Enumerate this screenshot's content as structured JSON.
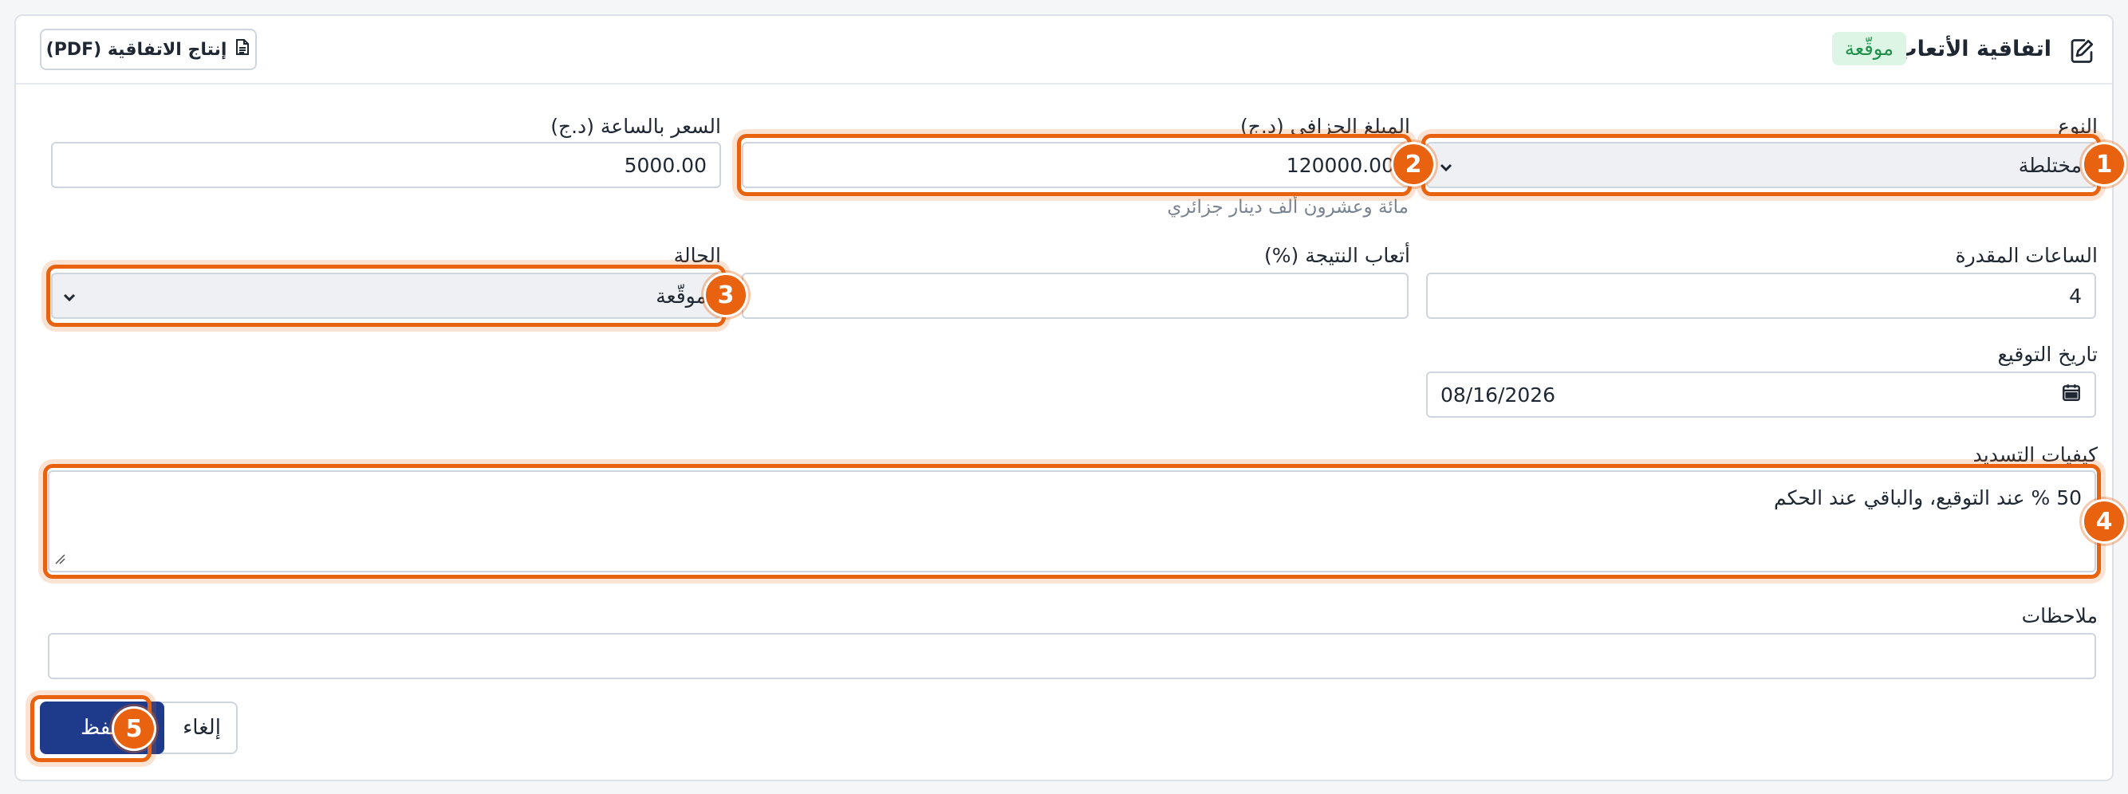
{
  "header": {
    "title": "اتفاقية الأتعاب",
    "status_badge": "موقّعة",
    "pdf_button": "إنتاج الاتفاقية (PDF)"
  },
  "form": {
    "type": {
      "label": "النوع",
      "value": "مختلطة"
    },
    "fixed_amount": {
      "label": "المبلغ الجزافي (د.ج)",
      "value": "120000.00",
      "hint": "مائة وعشرون ألف دينار جزائري"
    },
    "hourly_rate": {
      "label": "السعر بالساعة (د.ج)",
      "value": "5000.00"
    },
    "estimated_hours": {
      "label": "الساعات المقدرة",
      "value": "4"
    },
    "result_fee": {
      "label": "أتعاب النتيجة (%)",
      "value": ""
    },
    "status": {
      "label": "الحالة",
      "value": "موقّعة"
    },
    "signing_date": {
      "label": "تاريخ التوقيع",
      "value": "08/16/2026"
    },
    "payment_terms": {
      "label": "كيفيات التسديد",
      "value": "50 % عند التوقيع، والباقي عند الحكم"
    },
    "notes": {
      "label": "ملاحظات",
      "value": ""
    }
  },
  "actions": {
    "save": "حفظ",
    "cancel": "إلغاء"
  },
  "markers": [
    "1",
    "2",
    "3",
    "4",
    "5"
  ],
  "colors": {
    "accent": "#e8620f",
    "primary": "#1e3a8a",
    "badge_bg": "#dcf5e4",
    "badge_text": "#1f8f4a"
  }
}
